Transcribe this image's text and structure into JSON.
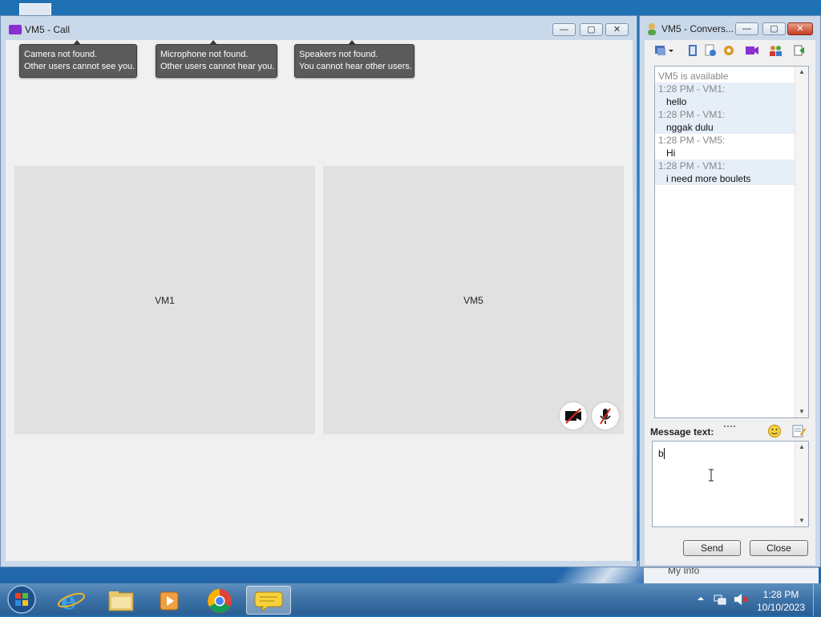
{
  "call_window": {
    "title": "VM5 - Call",
    "tooltips": [
      {
        "line1": "Camera not found.",
        "line2": "Other users cannot see you."
      },
      {
        "line1": "Microphone not found.",
        "line2": "Other users cannot hear you."
      },
      {
        "line1": "Speakers not found.",
        "line2": "You cannot hear other users."
      }
    ],
    "tiles": [
      {
        "label": "VM1"
      },
      {
        "label": "VM5"
      }
    ],
    "controls": {
      "minimize": "—",
      "maximize": "▢",
      "close": "✕"
    }
  },
  "conversation_window": {
    "title": "VM5 - Convers...",
    "status": "VM5 is available",
    "messages": [
      {
        "header": "1:28 PM - VM1:",
        "text": "hello",
        "highlight": true
      },
      {
        "header": "1:28 PM - VM1:",
        "text": "nggak dulu",
        "highlight": true
      },
      {
        "header": "1:28 PM - VM5:",
        "text": "Hi",
        "highlight": false
      },
      {
        "header": "1:28 PM - VM1:",
        "text": "i need more boulets",
        "highlight": true
      }
    ],
    "message_label": "Message text:",
    "message_value": "b",
    "send_label": "Send",
    "close_label": "Close",
    "under_text": "My Info",
    "controls": {
      "minimize": "—",
      "maximize": "▢",
      "close": "✕"
    }
  },
  "taskbar": {
    "time": "1:28 PM",
    "date": "10/10/2023"
  },
  "colors": {
    "video_accent": "#8a2fd0",
    "taskbar": "#3f74a8",
    "tile_bg": "#e1e1e1"
  }
}
